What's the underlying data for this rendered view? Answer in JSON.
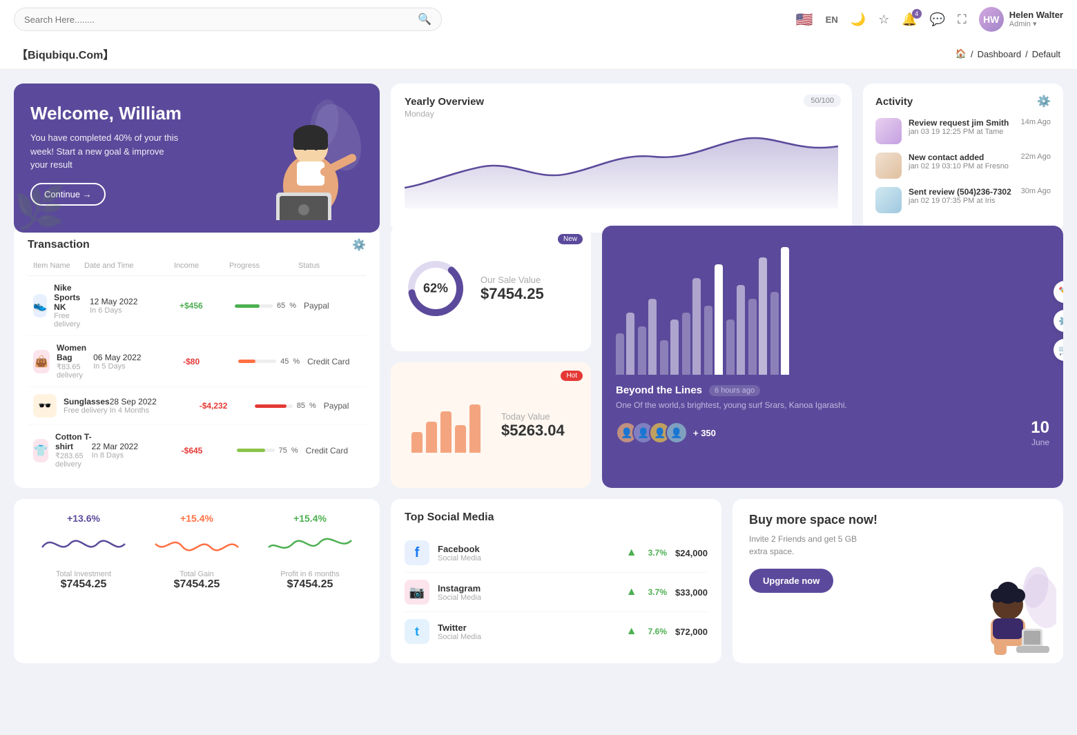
{
  "navbar": {
    "search_placeholder": "Search Here........",
    "lang": "EN",
    "user": {
      "name": "Helen Walter",
      "role": "Admin",
      "initials": "HW"
    },
    "notification_count": "4"
  },
  "breadcrumb": {
    "brand": "【Biqubiqu.Com】",
    "home": "🏠",
    "dashboard": "Dashboard",
    "current": "Default"
  },
  "welcome": {
    "title": "Welcome, William",
    "subtitle": "You have completed 40% of your this week! Start a new goal & improve your result",
    "button": "Continue →"
  },
  "yearly_overview": {
    "title": "Yearly Overview",
    "subtitle": "Monday",
    "badge": "50/100"
  },
  "activity": {
    "title": "Activity",
    "items": [
      {
        "title": "Review request jim Smith",
        "desc": "jan 03 19 12:25 PM at Tame",
        "time": "14m Ago"
      },
      {
        "title": "New contact added",
        "desc": "jan 02 19 03:10 PM at Fresno",
        "time": "22m Ago"
      },
      {
        "title": "Sent review (504)236-7302",
        "desc": "jan 02 19 07:35 PM at Iris",
        "time": "30m Ago"
      }
    ]
  },
  "transaction": {
    "title": "Transaction",
    "headers": [
      "Item Name",
      "Date and Time",
      "Income",
      "Progress",
      "Status"
    ],
    "rows": [
      {
        "name": "Nike Sports NK",
        "sub": "Free delivery",
        "date": "12 May 2022",
        "date_sub": "In 6 Days",
        "income": "+$456",
        "progress": 65,
        "status": "Paypal",
        "icon": "👟",
        "icon_bg": "#e8f0fe",
        "progress_color": "#4caf50"
      },
      {
        "name": "Women Bag",
        "sub": "₹83.65 delivery",
        "date": "06 May 2022",
        "date_sub": "In 5 Days",
        "income": "-$80",
        "progress": 45,
        "status": "Credit Card",
        "icon": "👜",
        "icon_bg": "#fce4ec",
        "progress_color": "#ff7043"
      },
      {
        "name": "Sunglasses",
        "sub": "Free delivery",
        "date": "28 Sep 2022",
        "date_sub": "In 4 Months",
        "income": "-$4,232",
        "progress": 85,
        "status": "Paypal",
        "icon": "🕶️",
        "icon_bg": "#fff3e0",
        "progress_color": "#e53935"
      },
      {
        "name": "Cotton T-shirt",
        "sub": "₹283.65 delivery",
        "date": "22 Mar 2022",
        "date_sub": "In 8 Days",
        "income": "-$645",
        "progress": 75,
        "status": "Credit Card",
        "icon": "👕",
        "icon_bg": "#fce4ec",
        "progress_color": "#8bc34a"
      }
    ]
  },
  "sale_value": {
    "donut_pct": "62%",
    "donut_value": 62,
    "label": "Our Sale Value",
    "value": "$7454.25",
    "badge": "New"
  },
  "today_value": {
    "label": "Today Value",
    "value": "$5263.04",
    "badge": "Hot"
  },
  "bar_chart": {
    "title": "Beyond the Lines",
    "time_ago": "6 hours ago",
    "desc": "One Of the world,s brightest, young surf Srars, Kanoa Igarashi.",
    "plus_count": "+ 350",
    "date_num": "10",
    "date_month": "June"
  },
  "mini_stats": [
    {
      "pct": "+13.6%",
      "pct_color": "#5b4a9b",
      "label": "Total Investment",
      "value": "$7454.25"
    },
    {
      "pct": "+15.4%",
      "pct_color": "#ff7043",
      "label": "Total Gain",
      "value": "$7454.25"
    },
    {
      "pct": "+15.4%",
      "pct_color": "#4caf50",
      "label": "Profit in 6 months",
      "value": "$7454.25"
    }
  ],
  "social_media": {
    "title": "Top Social Media",
    "items": [
      {
        "name": "Facebook",
        "type": "Social Media",
        "pct": "3.7%",
        "value": "$24,000",
        "icon": "f",
        "color": "#1877f2"
      },
      {
        "name": "Instagram",
        "type": "Social Media",
        "pct": "3.7%",
        "value": "$33,000",
        "icon": "📷",
        "color": "#e1306c"
      },
      {
        "name": "Twitter",
        "type": "Social Media",
        "pct": "7.6%",
        "value": "$72,000",
        "icon": "t",
        "color": "#1da1f2"
      }
    ]
  },
  "buy_space": {
    "title": "Buy more space now!",
    "desc": "Invite 2 Friends and get 5 GB extra space.",
    "button": "Upgrade now"
  }
}
